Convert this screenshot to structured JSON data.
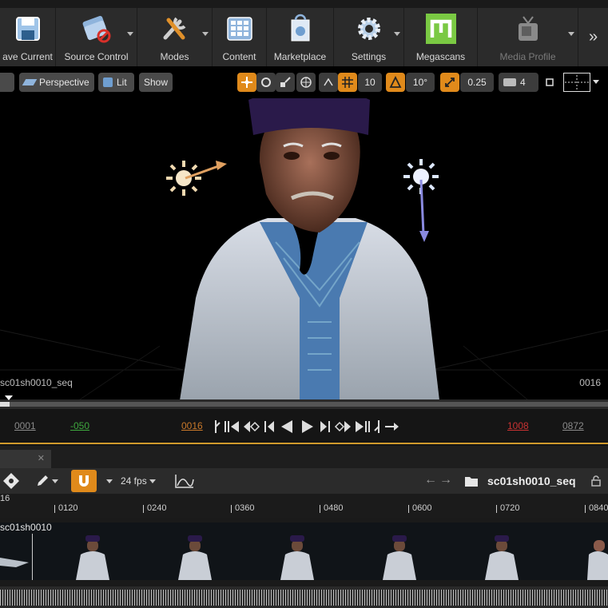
{
  "toolbar": {
    "buttons": [
      {
        "label": "ave Current"
      },
      {
        "label": "Source Control"
      },
      {
        "label": "Modes"
      },
      {
        "label": "Content"
      },
      {
        "label": "Marketplace"
      },
      {
        "label": "Settings"
      },
      {
        "label": "Megascans"
      },
      {
        "label": "Media Profile"
      }
    ]
  },
  "viewport": {
    "perspective": "Perspective",
    "lit": "Lit",
    "show": "Show",
    "grid_snap": "10",
    "rotation_snap": "10°",
    "scale_snap": "0.25",
    "camera_speed": "4",
    "sequence_name": "sc01sh0010_seq",
    "current_frame": "0016"
  },
  "transport": {
    "start_frame": "0001",
    "offset": "-050",
    "current": "0016",
    "end_frame": "1008",
    "out_frame": "0872"
  },
  "sequencer": {
    "fps": "24 fps",
    "sequence": "sc01sh0010_seq",
    "ruler_left": "16",
    "ruler_ticks": [
      "0120",
      "0240",
      "0360",
      "0480",
      "0600",
      "0720",
      "0840"
    ],
    "shot_name": "sc01sh0010"
  },
  "colors": {
    "accent": "#e08a1b",
    "end_frame": "#c83232",
    "offset": "#3ea83e"
  }
}
